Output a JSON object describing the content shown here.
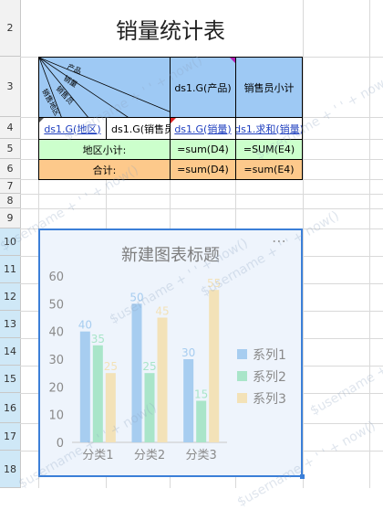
{
  "row_headers": [
    {
      "label": "2",
      "selected": false
    },
    {
      "label": "3",
      "selected": false
    },
    {
      "label": "4",
      "selected": false
    },
    {
      "label": "5",
      "selected": false
    },
    {
      "label": "6",
      "selected": false
    },
    {
      "label": "7",
      "selected": false
    },
    {
      "label": "8",
      "selected": false
    },
    {
      "label": "9",
      "selected": false
    },
    {
      "label": "10",
      "selected": true
    },
    {
      "label": "11",
      "selected": true
    },
    {
      "label": "12",
      "selected": true
    },
    {
      "label": "13",
      "selected": true
    },
    {
      "label": "14",
      "selected": true
    },
    {
      "label": "15",
      "selected": true
    },
    {
      "label": "16",
      "selected": true
    },
    {
      "label": "17",
      "selected": true
    },
    {
      "label": "18",
      "selected": true
    }
  ],
  "report": {
    "title": "销量统计表",
    "diag_labels": [
      "产品",
      "销量",
      "销售员",
      "销售地区"
    ],
    "header_product": "ds1.G(产品)",
    "header_salesman_subtotal": "销售员小计",
    "row4": {
      "region": "ds1.G(地区)",
      "salesman": "ds1.G(销售员)",
      "sales": "ds1.G(销量)",
      "sum": "ds1.求和(销量)"
    },
    "row5": {
      "label": "地区小计:",
      "f1": "=sum(D4)",
      "f2": "=SUM(E4)"
    },
    "row6": {
      "label": "合计:",
      "f1": "=sum(D4)",
      "f2": "=sum(E4)"
    }
  },
  "watermark": "$username + ' ' + now()",
  "chart": {
    "menu": "⋯"
  },
  "chart_data": {
    "type": "bar",
    "title": "新建图表标题",
    "categories": [
      "分类1",
      "分类2",
      "分类3"
    ],
    "series": [
      {
        "name": "系列1",
        "values": [
          40,
          50,
          30
        ],
        "color": "#a7cdf0"
      },
      {
        "name": "系列2",
        "values": [
          35,
          25,
          15
        ],
        "color": "#a9e5c9"
      },
      {
        "name": "系列3",
        "values": [
          25,
          45,
          55
        ],
        "color": "#f3e2b8"
      }
    ],
    "ylim": [
      0,
      60
    ],
    "yticks": [
      "0",
      "10",
      "20",
      "30",
      "40",
      "50",
      "60"
    ],
    "legend_position": "right",
    "grid": false,
    "xlabel": "",
    "ylabel": ""
  }
}
